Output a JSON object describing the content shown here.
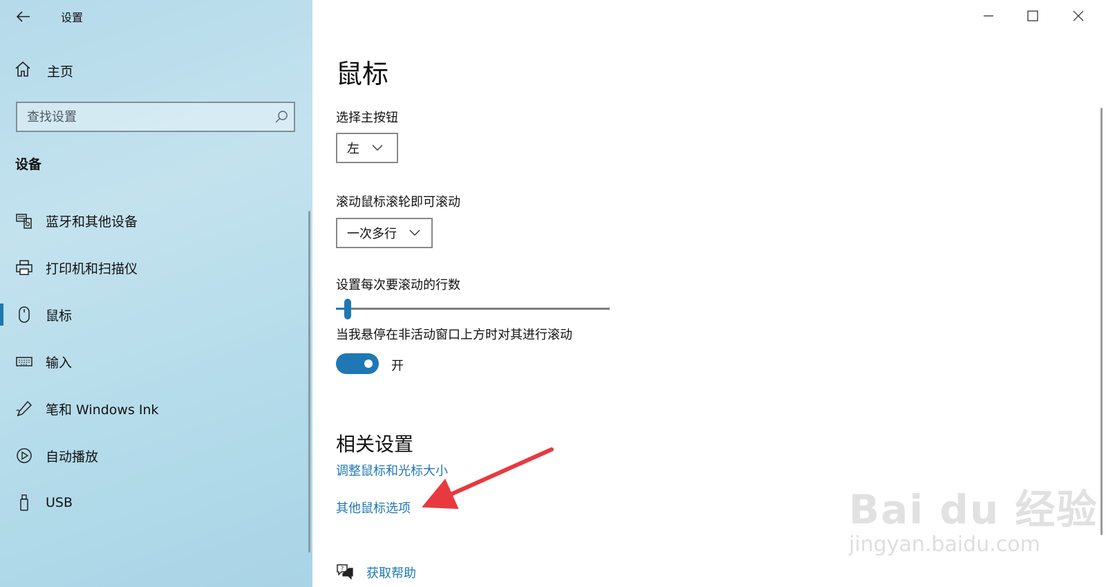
{
  "window": {
    "title": "设置",
    "controls": {
      "minimize": "minimize-icon",
      "maximize": "maximize-icon",
      "close": "close-icon"
    }
  },
  "sidebar": {
    "home_label": "主页",
    "search_placeholder": "查找设置",
    "section_title": "设备",
    "items": [
      {
        "label": "蓝牙和其他设备",
        "icon": "bluetooth-devices-icon",
        "active": false
      },
      {
        "label": "打印机和扫描仪",
        "icon": "printer-icon",
        "active": false
      },
      {
        "label": "鼠标",
        "icon": "mouse-icon",
        "active": true
      },
      {
        "label": "输入",
        "icon": "keyboard-icon",
        "active": false
      },
      {
        "label": "笔和 Windows Ink",
        "icon": "pen-icon",
        "active": false
      },
      {
        "label": "自动播放",
        "icon": "autoplay-icon",
        "active": false
      },
      {
        "label": "USB",
        "icon": "usb-icon",
        "active": false
      }
    ]
  },
  "main": {
    "title": "鼠标",
    "primary_button": {
      "label": "选择主按钮",
      "value": "左"
    },
    "scroll_wheel": {
      "label": "滚动鼠标滚轮即可滚动",
      "value": "一次多行"
    },
    "lines_to_scroll": {
      "label": "设置每次要滚动的行数",
      "value_fraction": 0.03
    },
    "inactive_scroll": {
      "label": "当我悬停在非活动窗口上方时对其进行滚动",
      "state": "开",
      "on": true
    },
    "related": {
      "title": "相关设置",
      "links": [
        "调整鼠标和光标大小",
        "其他鼠标选项"
      ]
    },
    "help_label": "获取帮助"
  },
  "watermark": {
    "logo": "Bai du 经验",
    "url": "jingyan.baidu.com"
  },
  "colors": {
    "accent": "#1f78b4",
    "annotation_arrow": "#e8393f"
  }
}
